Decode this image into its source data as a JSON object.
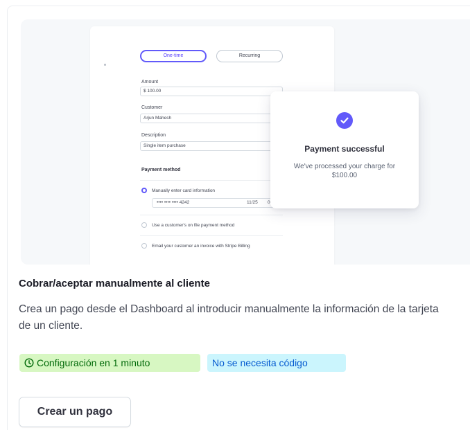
{
  "illustration": {
    "toggle": {
      "one_time": "One-time",
      "recurring": "Recurring"
    },
    "fields": {
      "amount_label": "Amount",
      "amount_value": "$ 100.00",
      "customer_label": "Customer",
      "customer_value": "Arjun Mahesh",
      "description_label": "Description",
      "description_value": "Single item purchase"
    },
    "payment_method": {
      "heading": "Payment method",
      "options": [
        "Manually enter card information",
        "Use a customer's on file payment method",
        "Email your customer an invoice with Stripe Billing"
      ],
      "card_number": "•••• •••• •••• 4242",
      "card_expiry": "11/25",
      "card_cvc": "00"
    },
    "success_popup": {
      "title": "Payment successful",
      "message": "We've processed your charge for $100.00"
    }
  },
  "card": {
    "title": "Cobrar/aceptar manualmente al cliente",
    "description": "Crea un pago desde el Dashboard al introducir manualmente la información de la tarjeta de un cliente.",
    "badges": {
      "setup_time": "Configuración en 1 minuto",
      "no_code": "No se necesita código"
    },
    "button_label": "Crear un pago"
  },
  "colors": {
    "accent": "#625afa",
    "badge_green_bg": "#d7f7c2",
    "badge_green_text": "#006908",
    "badge_blue_bg": "#cbf5fd",
    "badge_blue_text": "#045ad0"
  }
}
